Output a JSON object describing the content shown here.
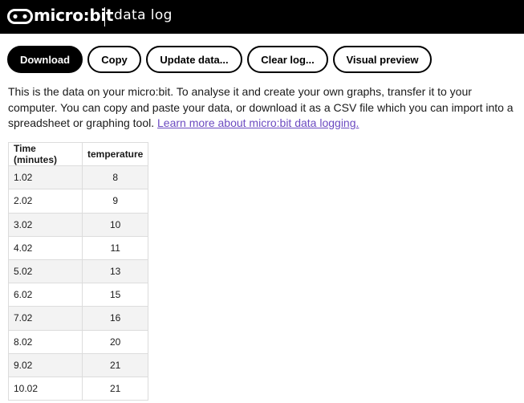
{
  "header": {
    "brand": "micro:bit",
    "subtitle": "data log",
    "logo_icon": "microbit-logo-icon",
    "background": "#000000"
  },
  "toolbar": {
    "buttons": [
      {
        "label": "Download",
        "primary": true
      },
      {
        "label": "Copy",
        "primary": false
      },
      {
        "label": "Update data...",
        "primary": false
      },
      {
        "label": "Clear log...",
        "primary": false
      },
      {
        "label": "Visual preview",
        "primary": false
      }
    ]
  },
  "intro": {
    "text": "This is the data on your micro:bit. To analyse it and create your own graphs, transfer it to your computer. You can copy and paste your data, or download it as a CSV file which you can import into a spreadsheet or graphing tool.",
    "link_text": "Learn more about micro:bit data logging.",
    "link_color": "#6c4bc1"
  },
  "table": {
    "columns": [
      "Time (minutes)",
      "temperature"
    ],
    "rows": [
      [
        "1.02",
        "8"
      ],
      [
        "2.02",
        "9"
      ],
      [
        "3.02",
        "10"
      ],
      [
        "4.02",
        "11"
      ],
      [
        "5.02",
        "13"
      ],
      [
        "6.02",
        "15"
      ],
      [
        "7.02",
        "16"
      ],
      [
        "8.02",
        "20"
      ],
      [
        "9.02",
        "21"
      ],
      [
        "10.02",
        "21"
      ]
    ]
  }
}
